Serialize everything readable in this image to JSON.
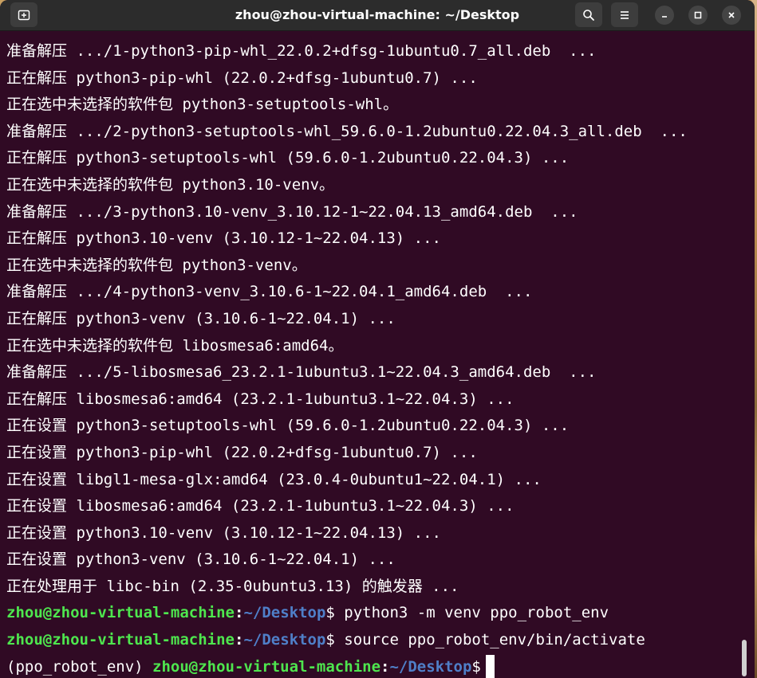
{
  "window": {
    "title": "zhou@zhou-virtual-machine: ~/Desktop"
  },
  "toolbar": {
    "new_tab_icon": "new-tab-icon",
    "search_icon": "search-icon",
    "menu_icon": "hamburger-menu-icon",
    "minimize_icon": "minimize-icon",
    "maximize_icon": "maximize-icon",
    "close_icon": "close-icon"
  },
  "terminal": {
    "lines": [
      "准备解压 .../1-python3-pip-whl_22.0.2+dfsg-1ubuntu0.7_all.deb  ...",
      "正在解压 python3-pip-whl (22.0.2+dfsg-1ubuntu0.7) ...",
      "正在选中未选择的软件包 python3-setuptools-whl。",
      "准备解压 .../2-python3-setuptools-whl_59.6.0-1.2ubuntu0.22.04.3_all.deb  ...",
      "正在解压 python3-setuptools-whl (59.6.0-1.2ubuntu0.22.04.3) ...",
      "正在选中未选择的软件包 python3.10-venv。",
      "准备解压 .../3-python3.10-venv_3.10.12-1~22.04.13_amd64.deb  ...",
      "正在解压 python3.10-venv (3.10.12-1~22.04.13) ...",
      "正在选中未选择的软件包 python3-venv。",
      "准备解压 .../4-python3-venv_3.10.6-1~22.04.1_amd64.deb  ...",
      "正在解压 python3-venv (3.10.6-1~22.04.1) ...",
      "正在选中未选择的软件包 libosmesa6:amd64。",
      "准备解压 .../5-libosmesa6_23.2.1-1ubuntu3.1~22.04.3_amd64.deb  ...",
      "正在解压 libosmesa6:amd64 (23.2.1-1ubuntu3.1~22.04.3) ...",
      "正在设置 python3-setuptools-whl (59.6.0-1.2ubuntu0.22.04.3) ...",
      "正在设置 python3-pip-whl (22.0.2+dfsg-1ubuntu0.7) ...",
      "正在设置 libgl1-mesa-glx:amd64 (23.0.4-0ubuntu1~22.04.1) ...",
      "正在设置 libosmesa6:amd64 (23.2.1-1ubuntu3.1~22.04.3) ...",
      "正在设置 python3.10-venv (3.10.12-1~22.04.13) ...",
      "正在设置 python3-venv (3.10.6-1~22.04.1) ...",
      "正在处理用于 libc-bin (2.35-0ubuntu3.13) 的触发器 ..."
    ],
    "prompt": {
      "user_host": "zhou@zhou-virtual-machine",
      "colon": ":",
      "path": "~/Desktop",
      "dollar": "$"
    },
    "commands": [
      " python3 -m venv ppo_robot_env",
      " source ppo_robot_env/bin/activate"
    ],
    "venv_prefix": "(ppo_robot_env) ",
    "current_input": ""
  },
  "colors": {
    "background": "#300a24",
    "prompt_user": "#4ee64e",
    "prompt_path": "#4f7fc8",
    "titlebar": "#2c2c2c"
  }
}
